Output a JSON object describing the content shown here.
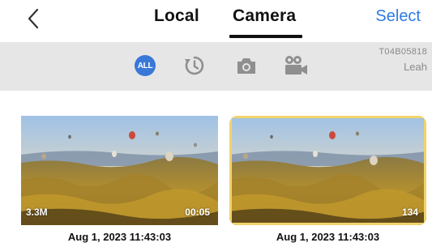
{
  "header": {
    "tabs": [
      {
        "label": "Local",
        "active": false
      },
      {
        "label": "Camera",
        "active": true
      }
    ],
    "select_label": "Select"
  },
  "filters": {
    "all_label": "ALL",
    "items": [
      "all-icon",
      "recent-icon",
      "camera-icon",
      "video-camera-icon"
    ],
    "active": "all"
  },
  "device": {
    "id": "T04B05818",
    "name": "Leah"
  },
  "media": [
    {
      "type": "video",
      "size": "3.3M",
      "duration": "00:05",
      "date": "Aug 1, 2023 11:43:03"
    },
    {
      "type": "folder",
      "count": "134",
      "date": "Aug 1, 2023 11:43:03"
    }
  ],
  "colors": {
    "accent": "#2f7ae5",
    "active_filter": "#3a78d8",
    "filter_bar": "#e6e6e6",
    "folder": "#f2d36b"
  }
}
